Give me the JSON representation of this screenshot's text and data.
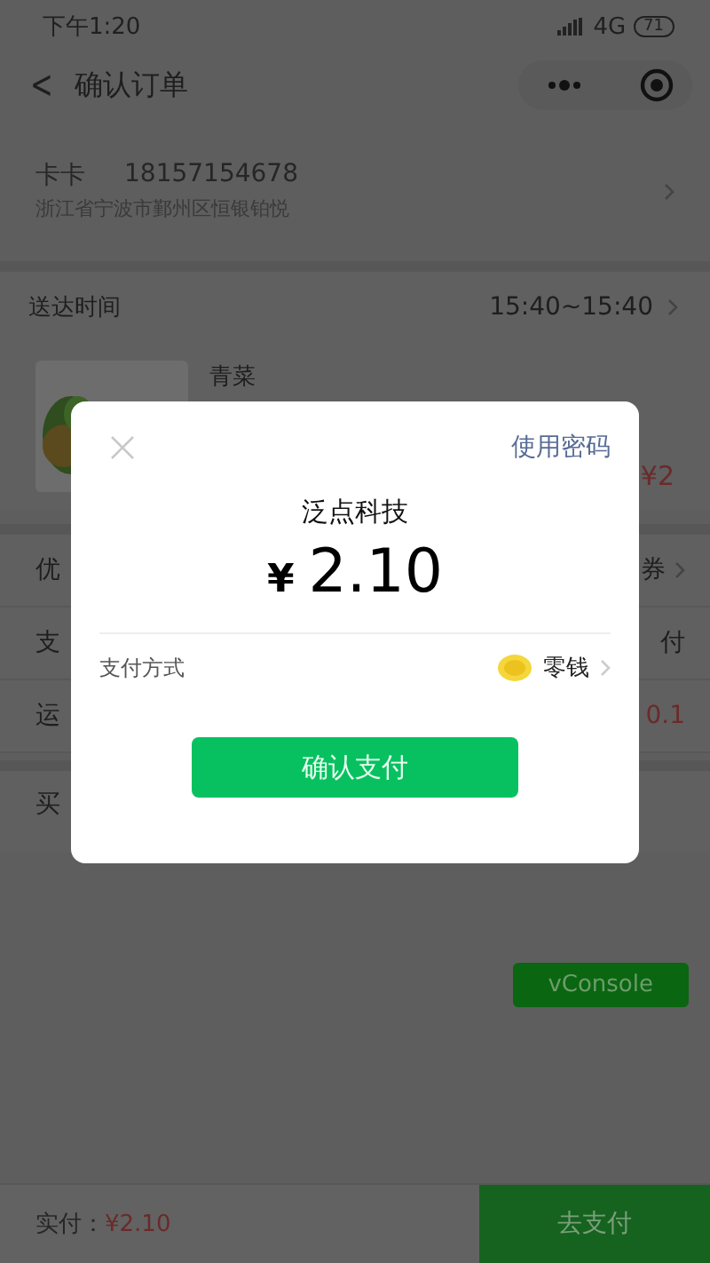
{
  "status_bar": {
    "time": "下午1:20",
    "network": "4G",
    "battery": "71"
  },
  "nav": {
    "back": "<",
    "title": "确认订单"
  },
  "address": {
    "name": "卡卡",
    "phone": "18157154678",
    "detail": "浙江省宁波市鄞州区恒银铂悦"
  },
  "delivery": {
    "label": "送达时间",
    "value": "15:40~15:40"
  },
  "product": {
    "name": "青菜",
    "price": "¥2"
  },
  "rows": [
    {
      "label": "优",
      "value": "券",
      "chevron": true,
      "kind": "plain"
    },
    {
      "label": "支",
      "value": "付",
      "chevron": false,
      "kind": "plain"
    },
    {
      "label": "运",
      "value": "0.1",
      "chevron": false,
      "kind": "price"
    }
  ],
  "message": {
    "label": "买"
  },
  "vconsole": "vConsole",
  "footer": {
    "label": "实付：",
    "amount": "¥2.10",
    "button": "去支付"
  },
  "dialog": {
    "switch": "使用密码",
    "merchant": "泛点科技",
    "currency": "¥",
    "amount": "2.10",
    "method_label": "支付方式",
    "method": "零钱",
    "confirm": "确认支付"
  }
}
